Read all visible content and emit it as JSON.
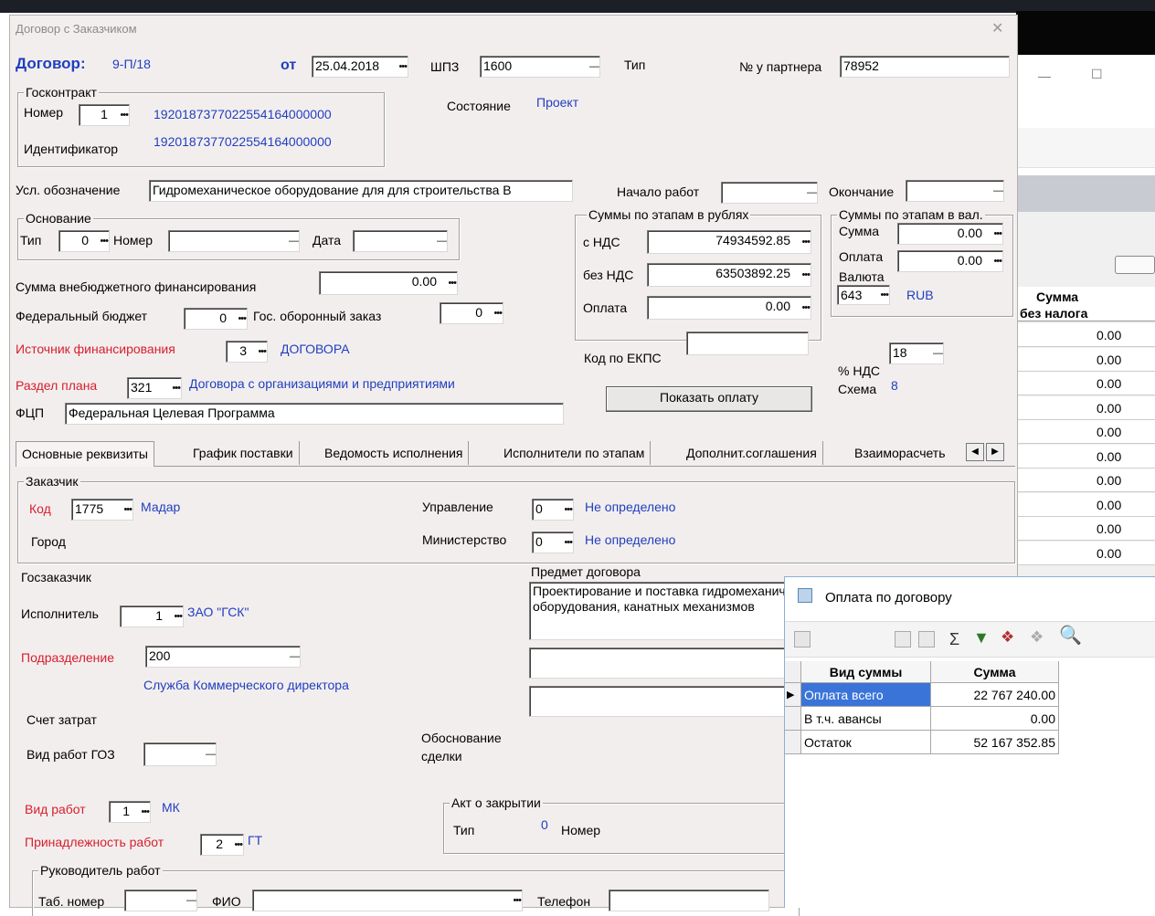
{
  "dialog": {
    "title": "Договор с Заказчиком",
    "close": "✕"
  },
  "header": {
    "contract_label": "Договор:",
    "contract_number": "9-П/18",
    "from_label": "от",
    "from_date": "25.04.2018",
    "shpz_label": "ШПЗ",
    "shpz_value": "1600",
    "type_label": "Тип",
    "partner_label": "№ у партнера",
    "partner_value": "78952",
    "state_label": "Состояние",
    "state_value": "Проект"
  },
  "goscontract": {
    "title": "Госконтракт",
    "number_label": "Номер",
    "number_value": "1",
    "number_text": "1920187377022554164000000",
    "ident_label": "Идентификатор",
    "ident_text": "1920187377022554164000000"
  },
  "designation": {
    "label": "Усл. обозначение",
    "value": "Гидромеханическое оборудование для для строительства В",
    "start_label": "Начало работ",
    "end_label": "Окончание"
  },
  "basis": {
    "title": "Основание",
    "type_label": "Тип",
    "type_value": "0",
    "number_label": "Номер",
    "date_label": "Дата"
  },
  "sums_rub": {
    "title": "Суммы по этапам в рублях",
    "vat_label": "с НДС",
    "vat_value": "74934592.85",
    "novat_label": "без НДС",
    "novat_value": "63503892.25",
    "pay_label": "Оплата",
    "pay_value": "0.00"
  },
  "sums_cur": {
    "title": "Суммы по этапам в вал.",
    "sum_label": "Сумма",
    "sum_value": "0.00",
    "pay_label": "Оплата",
    "pay_value": "0.00",
    "currency_label": "Валюта",
    "currency_code": "643",
    "currency_name": "RUB"
  },
  "finance": {
    "extra_label": "Сумма внебюджетного финансирования",
    "extra_value": "0.00",
    "federal_label": "Федеральный бюджет",
    "federal_value": "0",
    "defense_label": "Гос. оборонный заказ",
    "defense_value": "0",
    "source_label": "Источник финансирования",
    "source_value": "3",
    "source_text": "ДОГОВОРА",
    "plan_label": "Раздел плана",
    "plan_value": "321",
    "plan_text": "Договора с организациями и предприятиями",
    "fcp_label": "ФЦП",
    "fcp_value": "Федеральная Целевая Программа",
    "ekps_label": "Код по ЕКПС",
    "nds_label": "% НДС",
    "nds_value": "18",
    "scheme_label": "Схема",
    "scheme_value": "8",
    "show_payment": "Показать оплату"
  },
  "tabs": [
    "Основные реквизиты",
    "График поставки",
    "Ведомость исполнения",
    "Исполнители по этапам",
    "Дополнит.соглашения",
    "Взаиморасчеть"
  ],
  "customer": {
    "title": "Заказчик",
    "code_label": "Код",
    "code_value": "1775",
    "code_text": "Мадар",
    "city_label": "Город",
    "mgmt_label": "Управление",
    "mgmt_value": "0",
    "mgmt_text": "Не определено",
    "ministry_label": "Министерство",
    "ministry_value": "0",
    "ministry_text": "Не определено"
  },
  "lower": {
    "goszakaz_label": "Госзаказчик",
    "subject_label": "Предмет договора",
    "subject_line1": "Проектирование и поставка гидромеханического",
    "subject_line2": "оборудования, канатных механизмов",
    "executor_label": "Исполнитель",
    "executor_value": "1",
    "executor_text": "ЗАО \"ГСК\"",
    "division_label": "Подразделение",
    "division_value": "200",
    "division_text": "Служба Коммерческого директора",
    "account_label": "Счет затрат",
    "goz_label": "Вид работ ГОЗ",
    "deal_label1": "Обоснование",
    "deal_label2": "сделки",
    "work_label": "Вид работ",
    "work_value": "1",
    "work_text": "МК",
    "belong_label": "Принадлежность работ",
    "belong_value": "2",
    "belong_text": "ГТ",
    "act_title": "Акт о закрытии",
    "act_type_label": "Тип",
    "act_type_value": "0",
    "act_number_label": "Номер",
    "head_title": "Руководитель работ",
    "tab_label": "Таб. номер",
    "fio_label": "ФИО",
    "phone_label": "Телефон"
  },
  "payment_window": {
    "title": "Оплата по договору",
    "col_type": "Вид суммы",
    "col_sum": "Сумма",
    "rows": [
      {
        "type": "Оплата всего",
        "sum": "22 767 240.00"
      },
      {
        "type": "В т.ч. авансы",
        "sum": "0.00"
      },
      {
        "type": "Остаток",
        "sum": "52 167 352.85"
      }
    ]
  },
  "background_grid": {
    "header1": "Сумма",
    "header2": "без налога",
    "values": [
      "0.00",
      "0.00",
      "0.00",
      "0.00",
      "0.00",
      "0.00",
      "0.00",
      "0.00",
      "0.00",
      "0.00"
    ],
    "minimize": "—",
    "maximize": "☐"
  },
  "colors": {
    "dialog_bg": "#f3eeee",
    "required_red": "#d61f2c",
    "link_blue": "#1f3fbf",
    "selection_blue": "#3a74d8"
  }
}
